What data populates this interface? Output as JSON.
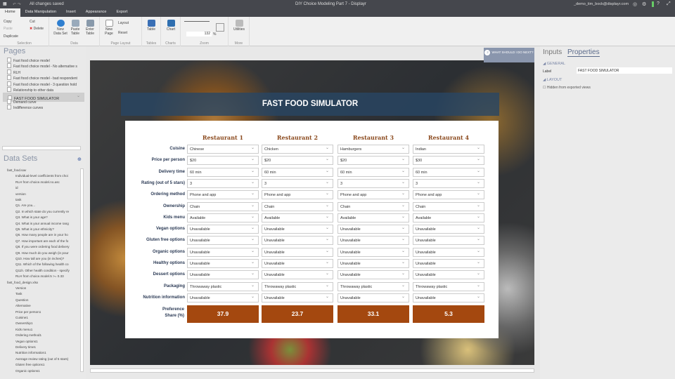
{
  "topbar": {
    "status": "All changes saved",
    "title": "DIY Choice Modeling Part 7 - Displayr",
    "user": "_demo_tim_bock@displayr.com"
  },
  "tabs": [
    "Home",
    "Data Manipulation",
    "Insert",
    "Appearance",
    "Export"
  ],
  "ribbon": {
    "copy": "Copy",
    "paste": "Paste",
    "duplicate": "Duplicate",
    "cut": "Cut",
    "delete": "Delete",
    "selection": "Selection",
    "new_data_set": "New Data Set",
    "paste_table": "Paste Table",
    "enter_table": "Enter Table",
    "data": "Data",
    "new_page": "New Page",
    "layout": "Layout",
    "reset": "Reset",
    "page_layout": "Page Layout",
    "table": "Table",
    "tables": "Tables",
    "chart": "Chart",
    "charts": "Charts",
    "zoom_value": "132",
    "zoom_unit": "%",
    "zoom": "Zoom",
    "utilities": "Utilities",
    "more": "More"
  },
  "pages": {
    "title": "Pages",
    "items": [
      "Fast food choice model",
      "Fast food choice model - No alternative s",
      "RLH",
      "Fast food choice model - bad respondent",
      "Fast food choice model - 3 question hold",
      "Relationship to other data",
      "FAST FOOD SIMULATOR",
      "Demand curve",
      "Indifference curves"
    ],
    "selected": 6
  },
  "datasets": {
    "title": "Data Sets",
    "items": [
      "fast_food.sav",
      "Individual-level coefficients from choi",
      "RLH from choice.model.no.asc",
      "id",
      "version",
      "task",
      "Q1. Are you...",
      "Q2. In which state do you currently re",
      "Q3. What is your age?",
      "Q4. What is your annual income rang",
      "Q5. What is your ethnicity?",
      "Q6. How many people are in your ho",
      "Q7. How important are each of the fo",
      "Q8. If you were ordering food delivery",
      "Q9. How much do you weigh (in pour",
      "Q10. How tall are you (in inches)?",
      "Q11. Which of the following health co",
      "Q11h. Other health condition - specify",
      "RLH from choice.model.5 >= 0.33",
      "fast_food_design.xlsx",
      "Version",
      "Task",
      "Question",
      "Alternative",
      "Price per person1",
      "Cuisine1",
      "Ownership1",
      "Kids menu1",
      "Ordering method1",
      "Vegan options1",
      "Delivery time1",
      "Nutrition information1",
      "Average review rating (out of 5 stars)",
      "Gluten free options1",
      "Organic options1"
    ]
  },
  "simulator": {
    "title": "FAST FOOD SIMULATOR",
    "restaurants": [
      "Restaurant 1",
      "Restaurant 2",
      "Restaurant 3",
      "Restaurant 4"
    ],
    "attributes": [
      "Cuisine",
      "Price per person",
      "Delivery time",
      "Rating (out of 5 stars)",
      "Ordering method",
      "Ownership",
      "Kids menu",
      "Vegan options",
      "Gluten free options",
      "Organic options",
      "Healthy options",
      "Dessert options",
      "Packaging",
      "Nutrition information"
    ],
    "values": [
      [
        "Chinese",
        "Chicken",
        "Hamburgers",
        "Indian"
      ],
      [
        "$20",
        "$20",
        "$20",
        "$30"
      ],
      [
        "60 min",
        "60 min",
        "60 min",
        "60 min"
      ],
      [
        "3",
        "3",
        "3",
        "3"
      ],
      [
        "Phone and app",
        "Phone and app",
        "Phone and app",
        "Phone and app"
      ],
      [
        "Chain",
        "Chain",
        "Chain",
        "Chain"
      ],
      [
        "Available",
        "Available",
        "Available",
        "Available"
      ],
      [
        "Unavailable",
        "Unavailable",
        "Unavailable",
        "Unavailable"
      ],
      [
        "Unavailable",
        "Unavailable",
        "Unavailable",
        "Unavailable"
      ],
      [
        "Unavailable",
        "Unavailable",
        "Unavailable",
        "Unavailable"
      ],
      [
        "Unavailable",
        "Unavailable",
        "Unavailable",
        "Unavailable"
      ],
      [
        "Unavailable",
        "Unavailable",
        "Unavailable",
        "Unavailable"
      ],
      [
        "Throwaway plastic",
        "Throwaway plastic",
        "Throwaway plastic",
        "Throwaway plastic"
      ],
      [
        "Unavailable",
        "Unavailable",
        "Unavailable",
        "Unavailable"
      ]
    ],
    "share_label_1": "Preference",
    "share_label_2": "Share (%)",
    "shares": [
      "37.9",
      "23.7",
      "33.1",
      "5.3"
    ]
  },
  "next": {
    "num": "2",
    "label": "WHAT SHOULD I DO NEXT?"
  },
  "right": {
    "tab_inputs": "Inputs",
    "tab_properties": "Properties",
    "general": "GENERAL",
    "label_label": "Label",
    "label_value": "FAST FOOD SIMULATOR",
    "layout": "LAYOUT",
    "hidden": "Hidden from exported views"
  }
}
